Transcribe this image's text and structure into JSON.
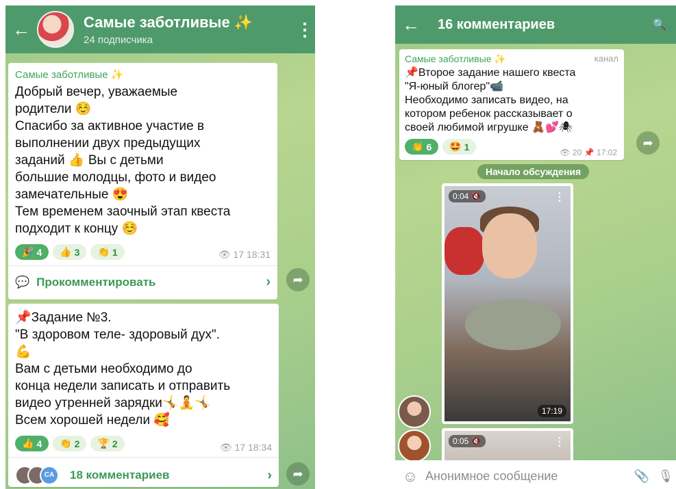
{
  "left": {
    "header": {
      "back": "←",
      "title": "Самые заботливые ✨",
      "subtitle": "24 подписчика",
      "menu": "⋮"
    },
    "post1": {
      "sender": "Самые заботливые ✨",
      "text": "Добрый вечер, уважаемые\nродители ☺️\nСпасибо за активное участие в\nвыполнении  двух предыдущих\nзаданий 👍 Вы с детьми\nбольшие молодцы, фото и видео\nзамечательные 😍\nТем временем заочный этап квеста\nподходит к концу ☺️",
      "reactions": [
        {
          "emoji": "🎉",
          "count": "4"
        },
        {
          "emoji": "👍",
          "count": "3"
        },
        {
          "emoji": "👏",
          "count": "1"
        }
      ],
      "views": "👁 17",
      "time": "18:31",
      "comment_label": "Прокомментировать",
      "comment_icon": "💬",
      "chevron": "›"
    },
    "post2": {
      "text": "📌Задание №3.\n\"В здоровом теле- здоровый дух\".\n💪\nВам с детьми необходимо до\nконца недели записать и отправить\nвидео утренней зарядки🤸🧘🤸\nВсем хорошей недели 🥰",
      "reactions": [
        {
          "emoji": "👍",
          "count": "4"
        },
        {
          "emoji": "👏",
          "count": "2"
        },
        {
          "emoji": "🏆",
          "count": "2"
        }
      ],
      "views": "👁 17",
      "time": "18:34",
      "comments": "18 комментариев",
      "avatar_ca": "CA",
      "chevron": "›"
    },
    "forward": "➦"
  },
  "right": {
    "header": {
      "back": "←",
      "title": "16 комментариев",
      "search": "🔍"
    },
    "post": {
      "sender": "Самые заботливые ✨",
      "channel": "канал",
      "text": "📌Второе задание нашего квеста\n\"Я-юный блогер\"📹\nНеобходимо записать видео, на\nкотором ребенок рассказывает о\nсвоей любимой игрушке 🧸💕🕷",
      "reactions": [
        {
          "emoji": "👏",
          "count": "6"
        },
        {
          "emoji": "🤩",
          "count": "1"
        }
      ],
      "views": "👁 20",
      "time": "📌 17:02"
    },
    "divider_label": "Начало обсуждения",
    "video1": {
      "time": "0:04 🔇",
      "duration": "17:19",
      "menu": "⋮"
    },
    "video2": {
      "time": "0:05 🔇",
      "menu": "⋮"
    },
    "forward": "➦",
    "input": {
      "emoji": "☺",
      "placeholder": "Анонимное сообщение",
      "attach": "📎",
      "mic": "🎙"
    }
  }
}
